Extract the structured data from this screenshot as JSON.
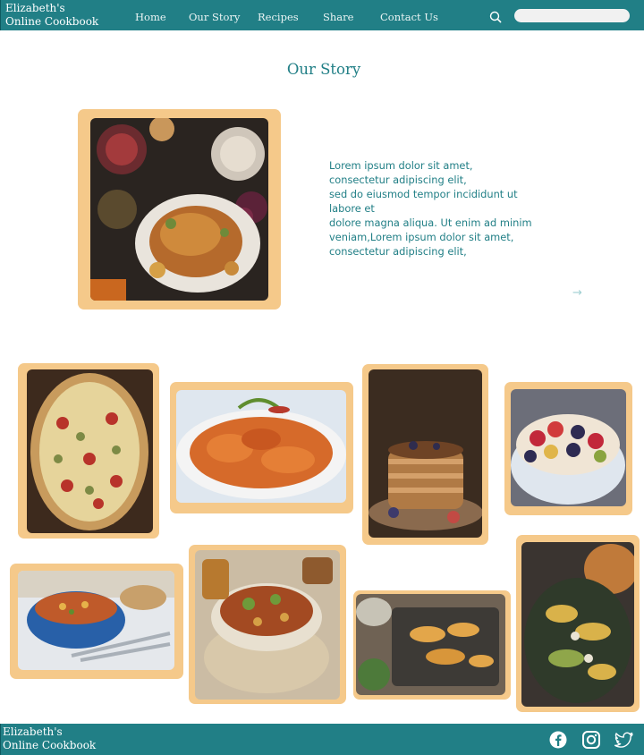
{
  "header": {
    "brand_line1": "Elizabeth's",
    "brand_line2": "Online Cookbook",
    "nav": [
      {
        "label": "Home"
      },
      {
        "label": "Our Story"
      },
      {
        "label": "Recipes"
      },
      {
        "label": "Share"
      },
      {
        "label": "Contact Us"
      }
    ],
    "search_placeholder": "",
    "search_icon": "search-icon"
  },
  "main": {
    "title": "Our Story",
    "story_lines": [
      "Lorem ipsum dolor sit amet,",
      "consectetur adipiscing elit,",
      "sed do eiusmod tempor incididunt ut labore et",
      "dolore magna aliqua. Ut enim ad minim veniam,Lorem ipsum dolor sit amet, consectetur adipiscing elit,"
    ],
    "next_arrow": "→",
    "gallery": [
      "featured-roast-chicken-photo",
      "quiche-photo",
      "penne-pasta-photo",
      "pancakes-photo",
      "fruit-bowl-photo",
      "soup-pot-photo",
      "veggie-bowl-photo",
      "squash-tray-photo",
      "stuffed-peppers-photo"
    ]
  },
  "footer": {
    "brand_line1": "Elizabeth's",
    "brand_line2": "Online Cookbook",
    "social": [
      "facebook-icon",
      "instagram-icon",
      "twitter-icon"
    ]
  },
  "colors": {
    "primary": "#217f86",
    "frame": "#f5c98a",
    "background": "#ffffff"
  }
}
